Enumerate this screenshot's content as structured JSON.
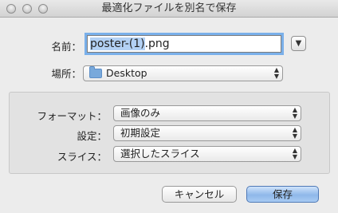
{
  "window": {
    "title": "最適化ファイルを別名で保存"
  },
  "save_as": {
    "label": "名前：",
    "filename_selected": "poster-(1)",
    "filename_ext": ".png"
  },
  "location": {
    "label": "場所：",
    "value": "Desktop"
  },
  "options": {
    "format": {
      "label": "フォーマット：",
      "value": "画像のみ"
    },
    "settings": {
      "label": "設定：",
      "value": "初期設定"
    },
    "slices": {
      "label": "スライス：",
      "value": "選択したスライス"
    }
  },
  "buttons": {
    "cancel": "キャンセル",
    "save": "保存"
  },
  "icons": {
    "disclosure": "disclosure-triangle-icon",
    "folder": "folder-icon",
    "popup_arrows": "updown-arrows-icon"
  },
  "colors": {
    "focus_ring": "#7ab0ea",
    "default_button": "#8fb8ea",
    "selection": "#b3d1f4"
  }
}
